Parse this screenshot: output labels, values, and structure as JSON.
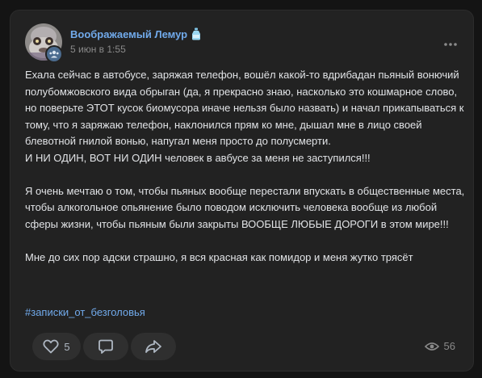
{
  "post": {
    "author": "Воображаемый Лемур",
    "date": "5 июн в 1:55",
    "text": "Ехала сейчас в автобусе, заряжая телефон, вошёл какой-то вдрибадан пьяный вонючий полубомжовского вида обрыган (да, я прекрасно знаю, насколько это кошмарное слово, но поверьте ЭТОТ кусок биомусора иначе нельзя было назвать) и начал прикапываться к тому, что я заряжаю телефон, наклонился прям ко мне, дышал мне в лицо своей блевотной гнилой вонью, напугал меня просто до полусмерти.\nИ НИ ОДИН, ВОТ НИ ОДИН человек в авбусе за меня не заступился!!!\n\nЯ очень мечтаю о том, чтобы пьяных вообще перестали впускать в общественные места, чтобы алкогольное опьянение было поводом исключить человека вообще из любой сферы жизни, чтобы пьяным были закрыты ВООБЩЕ ЛЮБЫЕ ДОРОГИ в этом мире!!!\n\nМне до сих пор адски страшно, я вся красная как помидор и меня жутко трясёт",
    "hashtag": "#записки_от_безголовья",
    "likes": "5",
    "views": "56"
  },
  "colors": {
    "background": "#141414",
    "card": "#222222",
    "accent": "#71aaeb",
    "text": "#e1e3e6",
    "muted": "#8a8a8a",
    "button": "#2f2f2f"
  },
  "icons": {
    "author_badge": "bottle-emoji-icon",
    "avatar_badge": "group-icon",
    "menu": "more-dots-icon",
    "like": "heart-icon",
    "comment": "comment-icon",
    "share": "share-arrow-icon",
    "views": "eye-icon"
  }
}
